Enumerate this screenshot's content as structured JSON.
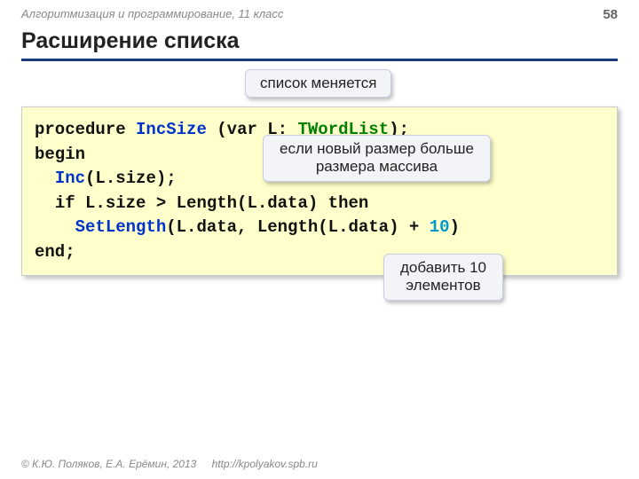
{
  "header": {
    "breadcrumb": "Алгоритмизация и программирование, 11 класс",
    "page": "58",
    "title": "Расширение списка"
  },
  "callouts": [
    {
      "text": "список меняется"
    },
    {
      "line1": "если новый размер больше",
      "line2": "размера массива"
    },
    {
      "line1": "добавить 10",
      "line2": "элементов"
    }
  ],
  "code": {
    "l1": {
      "t1": "procedure ",
      "t2": "IncSize",
      "t3": " (var L: ",
      "t4": "TWordList",
      "t5": ");"
    },
    "l2": "begin",
    "l3": {
      "t1": "Inc",
      "t2": "(L.size);"
    },
    "l4": "if L.size > Length(L.data)  then",
    "l5": {
      "t1": "SetLength",
      "t2": "(L.data, Length(L.data) +",
      "t3": "10",
      "t4": ")"
    },
    "l6": "end;"
  },
  "footer": {
    "copyright": "© К.Ю. Поляков, Е.А. Ерёмин, 2013",
    "url": "http://kpolyakov.spb.ru"
  }
}
